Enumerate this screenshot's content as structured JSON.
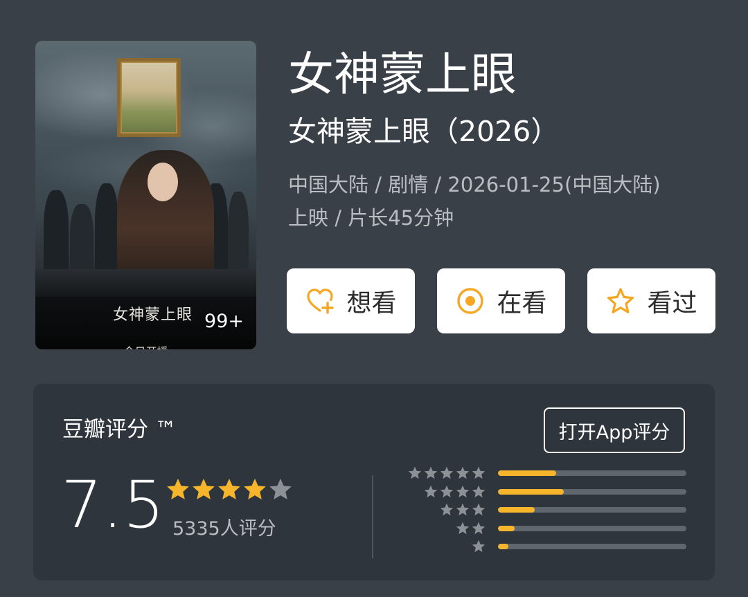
{
  "poster": {
    "title_text": "女神蒙上眼",
    "subtitle_text": "今日开播",
    "count_badge": "99+"
  },
  "info": {
    "title": "女神蒙上眼",
    "subtitle": "女神蒙上眼（2026）",
    "meta_line1": "中国大陆 / 剧情 / 2026-01-25(中国大陆)",
    "meta_line2": "上映 / 片长45分钟"
  },
  "actions": [
    {
      "label": "想看",
      "icon": "heart-plus-icon"
    },
    {
      "label": "在看",
      "icon": "target-circle-icon"
    },
    {
      "label": "看过",
      "icon": "star-outline-icon"
    }
  ],
  "rating": {
    "title": "豆瓣评分 ™",
    "open_app_label": "打开App评分",
    "score": "7.5",
    "stars_filled": 4,
    "stars_total": 5,
    "count_text": "5335人评分",
    "distribution": [
      {
        "stars": 5,
        "fraction": 0.31
      },
      {
        "stars": 4,
        "fraction": 0.35
      },
      {
        "stars": 3,
        "fraction": 0.195
      },
      {
        "stars": 2,
        "fraction": 0.09
      },
      {
        "stars": 1,
        "fraction": 0.055
      }
    ]
  },
  "colors": {
    "background": "#3a4048",
    "panel": "#2f353d",
    "accent_star": "#f7b52c",
    "muted_star": "#8c9198",
    "icon_orange": "#f5a623",
    "meta_text": "#b9bec4"
  }
}
